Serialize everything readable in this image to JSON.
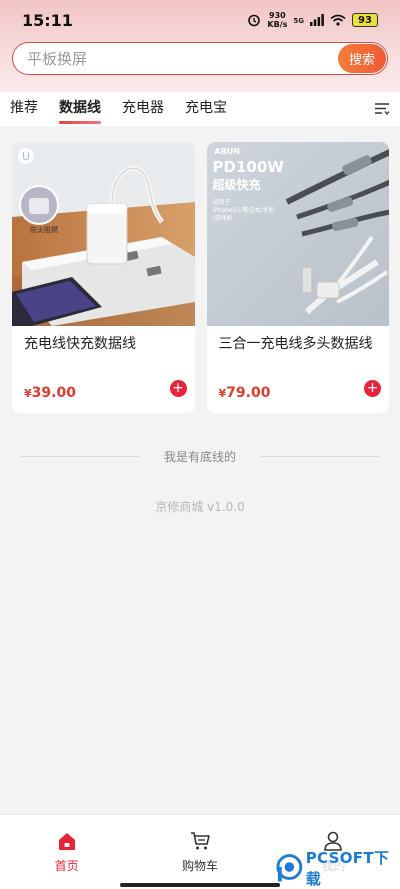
{
  "status_bar": {
    "time": "15:11",
    "net_speed_value": "930",
    "net_speed_unit": "KB/s",
    "signal_label": "5G",
    "battery": "93"
  },
  "search": {
    "placeholder": "平板换屏",
    "button_label": "搜索"
  },
  "categories": {
    "tabs": [
      {
        "label": "推荐",
        "active": false
      },
      {
        "label": "数据线",
        "active": true
      },
      {
        "label": "充电器",
        "active": false
      },
      {
        "label": "充电宝",
        "active": false
      }
    ],
    "filter_icon": "filter-list-icon"
  },
  "products": [
    {
      "title": "充电线快充数据线",
      "currency": "¥",
      "price": "39.00",
      "image_labels": {
        "badge": "防火阻燃"
      }
    },
    {
      "title": "三合一充电线多头数据线",
      "currency": "¥",
      "price": "79.00",
      "image_labels": {
        "brand": "ARUN",
        "headline": "PD100W",
        "subheadline": "超级快充",
        "compat_line1": "适用于",
        "compat_line2": "iPhone15/笔记本/手机",
        "compat_line3": "/游戏机"
      }
    }
  ],
  "footer": {
    "end_text": "我是有底线的",
    "version": "京修商城 v1.0.0"
  },
  "tabbar": {
    "items": [
      {
        "label": "首页",
        "icon": "home-icon",
        "active": true
      },
      {
        "label": "购物车",
        "icon": "cart-icon",
        "active": false
      },
      {
        "label": "我的",
        "icon": "user-icon",
        "active": false
      }
    ]
  },
  "watermark": {
    "text": "PCSOFT下载"
  },
  "colors": {
    "accent": "#e8243a",
    "price": "#e23b2e",
    "search_btn": "#f26a37",
    "header_bg": "#f2c4c4"
  }
}
